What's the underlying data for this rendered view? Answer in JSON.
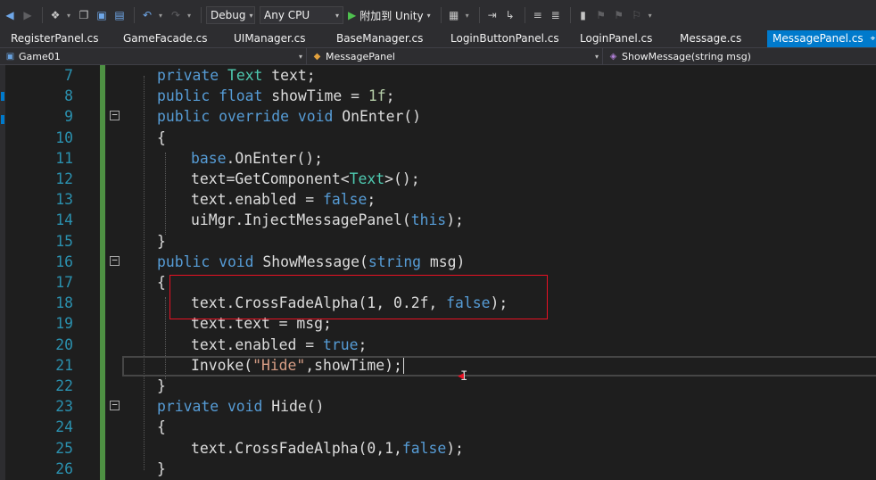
{
  "toolbar": {
    "config_value": "Debug",
    "platform_value": "Any CPU",
    "attach_label": "附加到 Unity"
  },
  "tabs": [
    {
      "label": "RegisterPanel.cs",
      "active": false
    },
    {
      "label": "GameFacade.cs",
      "active": false
    },
    {
      "label": "UIManager.cs",
      "active": false
    },
    {
      "label": "BaseManager.cs",
      "active": false
    },
    {
      "label": "LoginButtonPanel.cs",
      "active": false
    },
    {
      "label": "LoginPanel.cs",
      "active": false
    },
    {
      "label": "Message.cs",
      "active": false
    },
    {
      "label": "MessagePanel.cs",
      "active": true
    }
  ],
  "navbar": {
    "project": "Game01",
    "class": "MessagePanel",
    "member": "ShowMessage(string msg)"
  },
  "editor": {
    "lines": [
      {
        "n": "7",
        "indent": 0,
        "fold": false,
        "tokens": [
          [
            "kw",
            "private "
          ],
          [
            "ty",
            "Text"
          ],
          [
            "pl",
            " text;"
          ]
        ]
      },
      {
        "n": "8",
        "indent": 0,
        "fold": false,
        "tokens": [
          [
            "kw",
            "public float "
          ],
          [
            "pl",
            "showTime = "
          ],
          [
            "num",
            "1f"
          ],
          [
            "pl",
            ";"
          ]
        ]
      },
      {
        "n": "9",
        "indent": 0,
        "fold": true,
        "tokens": [
          [
            "kw",
            "public override void "
          ],
          [
            "pl",
            "OnEnter()"
          ]
        ]
      },
      {
        "n": "10",
        "indent": 0,
        "fold": false,
        "tokens": [
          [
            "pl",
            "{"
          ]
        ]
      },
      {
        "n": "11",
        "indent": 1,
        "fold": false,
        "tokens": [
          [
            "kw",
            "base"
          ],
          [
            "pl",
            ".OnEnter();"
          ]
        ]
      },
      {
        "n": "12",
        "indent": 1,
        "fold": false,
        "tokens": [
          [
            "pl",
            "text=GetComponent<"
          ],
          [
            "ty",
            "Text"
          ],
          [
            "pl",
            ">();"
          ]
        ]
      },
      {
        "n": "13",
        "indent": 1,
        "fold": false,
        "tokens": [
          [
            "pl",
            "text.enabled = "
          ],
          [
            "kw",
            "false"
          ],
          [
            "pl",
            ";"
          ]
        ]
      },
      {
        "n": "14",
        "indent": 1,
        "fold": false,
        "tokens": [
          [
            "pl",
            "uiMgr.InjectMessagePanel("
          ],
          [
            "kw",
            "this"
          ],
          [
            "pl",
            ");"
          ]
        ]
      },
      {
        "n": "15",
        "indent": 0,
        "fold": false,
        "tokens": [
          [
            "pl",
            "}"
          ]
        ]
      },
      {
        "n": "16",
        "indent": 0,
        "fold": true,
        "tokens": [
          [
            "kw",
            "public void "
          ],
          [
            "pl",
            "ShowMessage("
          ],
          [
            "kw",
            "string "
          ],
          [
            "pl",
            "msg)"
          ]
        ]
      },
      {
        "n": "17",
        "indent": 0,
        "fold": false,
        "tokens": [
          [
            "pl",
            "{"
          ]
        ]
      },
      {
        "n": "18",
        "indent": 1,
        "fold": false,
        "tokens": [
          [
            "pl",
            "text.CrossFadeAlpha(1, 0.2f, "
          ],
          [
            "kw",
            "false"
          ],
          [
            "pl",
            ");"
          ]
        ]
      },
      {
        "n": "19",
        "indent": 1,
        "fold": false,
        "tokens": [
          [
            "pl",
            "text.text = msg;"
          ]
        ]
      },
      {
        "n": "20",
        "indent": 1,
        "fold": false,
        "tokens": [
          [
            "pl",
            "text.enabled = "
          ],
          [
            "kw",
            "true"
          ],
          [
            "pl",
            ";"
          ]
        ]
      },
      {
        "n": "21",
        "indent": 1,
        "fold": false,
        "tokens": [
          [
            "pl",
            "Invoke("
          ],
          [
            "str",
            "\"Hide\""
          ],
          [
            "pl",
            ",showTime);"
          ]
        ]
      },
      {
        "n": "22",
        "indent": 0,
        "fold": false,
        "tokens": [
          [
            "pl",
            "}"
          ]
        ]
      },
      {
        "n": "23",
        "indent": 0,
        "fold": true,
        "tokens": [
          [
            "kw",
            "private void "
          ],
          [
            "pl",
            "Hide()"
          ]
        ]
      },
      {
        "n": "24",
        "indent": 0,
        "fold": false,
        "tokens": [
          [
            "pl",
            "{"
          ]
        ]
      },
      {
        "n": "25",
        "indent": 1,
        "fold": false,
        "tokens": [
          [
            "pl",
            "text.CrossFadeAlpha(0,1,"
          ],
          [
            "kw",
            "false"
          ],
          [
            "pl",
            ");"
          ]
        ]
      },
      {
        "n": "26",
        "indent": 0,
        "fold": false,
        "tokens": [
          [
            "pl",
            "}"
          ]
        ]
      }
    ]
  }
}
